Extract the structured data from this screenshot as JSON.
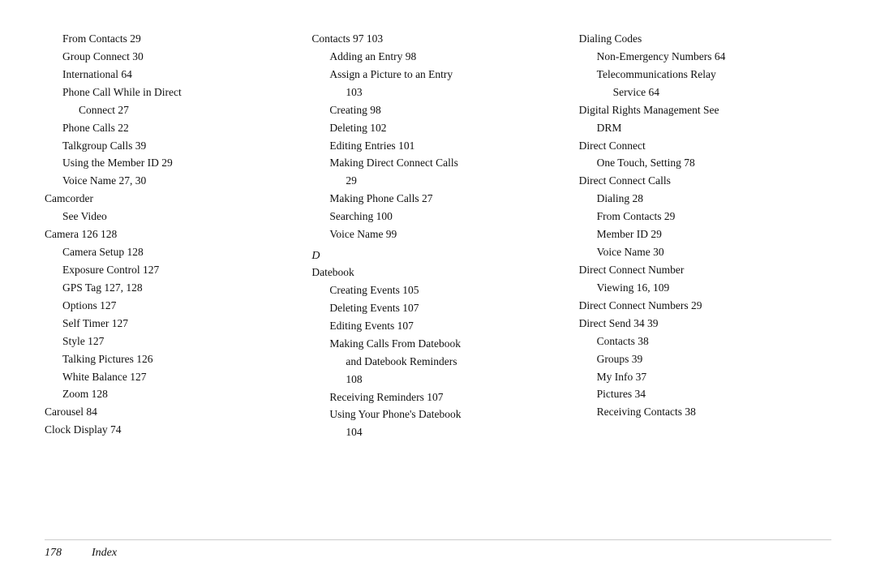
{
  "columns": [
    {
      "id": "col1",
      "entries": [
        {
          "level": "sub",
          "text": "From Contacts 29"
        },
        {
          "level": "sub",
          "text": "Group Connect 30"
        },
        {
          "level": "sub",
          "text": "International 64"
        },
        {
          "level": "sub",
          "text": "Phone Call While in Direct"
        },
        {
          "level": "sub2",
          "text": "Connect 27"
        },
        {
          "level": "sub",
          "text": "Phone Calls 22"
        },
        {
          "level": "sub",
          "text": "Talkgroup Calls 39"
        },
        {
          "level": "sub",
          "text": "Using the Member ID 29"
        },
        {
          "level": "sub",
          "text": "Voice Name 27, 30"
        },
        {
          "level": "main",
          "text": "Camcorder"
        },
        {
          "level": "sub",
          "text": "See Video"
        },
        {
          "level": "main",
          "text": "Camera 126  128"
        },
        {
          "level": "sub",
          "text": "Camera Setup 128"
        },
        {
          "level": "sub",
          "text": "Exposure Control 127"
        },
        {
          "level": "sub",
          "text": "GPS Tag 127, 128"
        },
        {
          "level": "sub",
          "text": "Options 127"
        },
        {
          "level": "sub",
          "text": "Self Timer 127"
        },
        {
          "level": "sub",
          "text": "Style 127"
        },
        {
          "level": "sub",
          "text": "Talking Pictures 126"
        },
        {
          "level": "sub",
          "text": "White Balance 127"
        },
        {
          "level": "sub",
          "text": "Zoom 128"
        },
        {
          "level": "main",
          "text": "Carousel 84"
        },
        {
          "level": "main",
          "text": "Clock Display 74"
        }
      ]
    },
    {
      "id": "col2",
      "entries": [
        {
          "level": "main",
          "text": "Contacts 97  103"
        },
        {
          "level": "sub",
          "text": "Adding an Entry 98"
        },
        {
          "level": "sub",
          "text": "Assign a Picture to an Entry"
        },
        {
          "level": "sub2",
          "text": "103"
        },
        {
          "level": "sub",
          "text": "Creating 98"
        },
        {
          "level": "sub",
          "text": "Deleting 102"
        },
        {
          "level": "sub",
          "text": "Editing Entries 101"
        },
        {
          "level": "sub",
          "text": "Making Direct Connect Calls"
        },
        {
          "level": "sub2",
          "text": "29"
        },
        {
          "level": "sub",
          "text": "Making Phone Calls 27"
        },
        {
          "level": "sub",
          "text": "Searching 100"
        },
        {
          "level": "sub",
          "text": "Voice Name 99"
        },
        {
          "level": "letter",
          "text": "D"
        },
        {
          "level": "main",
          "text": "Datebook"
        },
        {
          "level": "sub",
          "text": "Creating Events 105"
        },
        {
          "level": "sub",
          "text": "Deleting Events 107"
        },
        {
          "level": "sub",
          "text": "Editing Events 107"
        },
        {
          "level": "sub",
          "text": "Making Calls From Datebook"
        },
        {
          "level": "sub2",
          "text": "and Datebook Reminders"
        },
        {
          "level": "sub2",
          "text": "108"
        },
        {
          "level": "sub",
          "text": "Receiving Reminders 107"
        },
        {
          "level": "sub",
          "text": "Using Your Phone's Datebook"
        },
        {
          "level": "sub2",
          "text": "104"
        }
      ]
    },
    {
      "id": "col3",
      "entries": [
        {
          "level": "main",
          "text": "Dialing Codes"
        },
        {
          "level": "sub",
          "text": "Non-Emergency Numbers 64"
        },
        {
          "level": "sub",
          "text": "Telecommunications Relay"
        },
        {
          "level": "sub2",
          "text": "Service 64"
        },
        {
          "level": "main",
          "text": "Digital Rights Management See"
        },
        {
          "level": "sub",
          "text": "DRM"
        },
        {
          "level": "main",
          "text": "Direct Connect"
        },
        {
          "level": "sub",
          "text": "One Touch, Setting 78"
        },
        {
          "level": "main",
          "text": "Direct Connect Calls"
        },
        {
          "level": "sub",
          "text": "Dialing 28"
        },
        {
          "level": "sub",
          "text": "From Contacts 29"
        },
        {
          "level": "sub",
          "text": "Member ID 29"
        },
        {
          "level": "sub",
          "text": "Voice Name 30"
        },
        {
          "level": "main",
          "text": "Direct Connect Number"
        },
        {
          "level": "sub",
          "text": "Viewing 16, 109"
        },
        {
          "level": "main",
          "text": "Direct Connect Numbers 29"
        },
        {
          "level": "main",
          "text": "Direct Send 34  39"
        },
        {
          "level": "sub",
          "text": "Contacts 38"
        },
        {
          "level": "sub",
          "text": "Groups 39"
        },
        {
          "level": "sub",
          "text": "My Info 37"
        },
        {
          "level": "sub",
          "text": "Pictures 34"
        },
        {
          "level": "sub",
          "text": "Receiving Contacts 38"
        }
      ]
    }
  ],
  "footer": {
    "page": "178",
    "label": "Index"
  }
}
